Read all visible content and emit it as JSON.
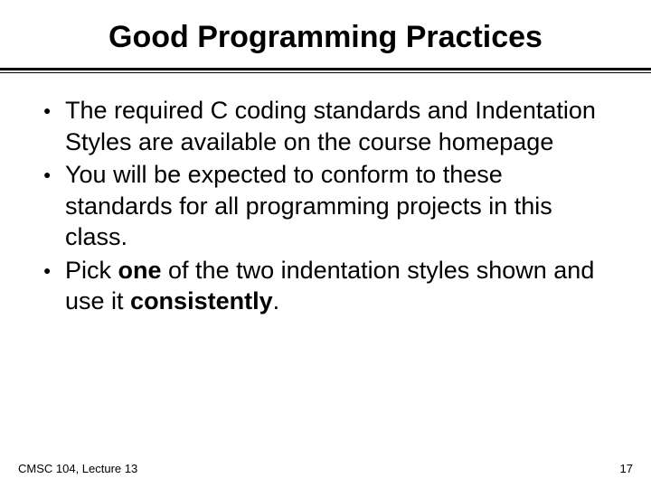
{
  "title": "Good Programming Practices",
  "bullets": [
    {
      "html": "The required C coding standards and Indentation Styles are available on the course homepage"
    },
    {
      "html": "You will be expected to conform to these standards for all programming projects in this class."
    },
    {
      "html": "Pick <b>one</b> of the two indentation styles shown and use it <b>consistently</b>."
    }
  ],
  "footer": {
    "left": "CMSC 104, Lecture 13",
    "right": "17"
  }
}
